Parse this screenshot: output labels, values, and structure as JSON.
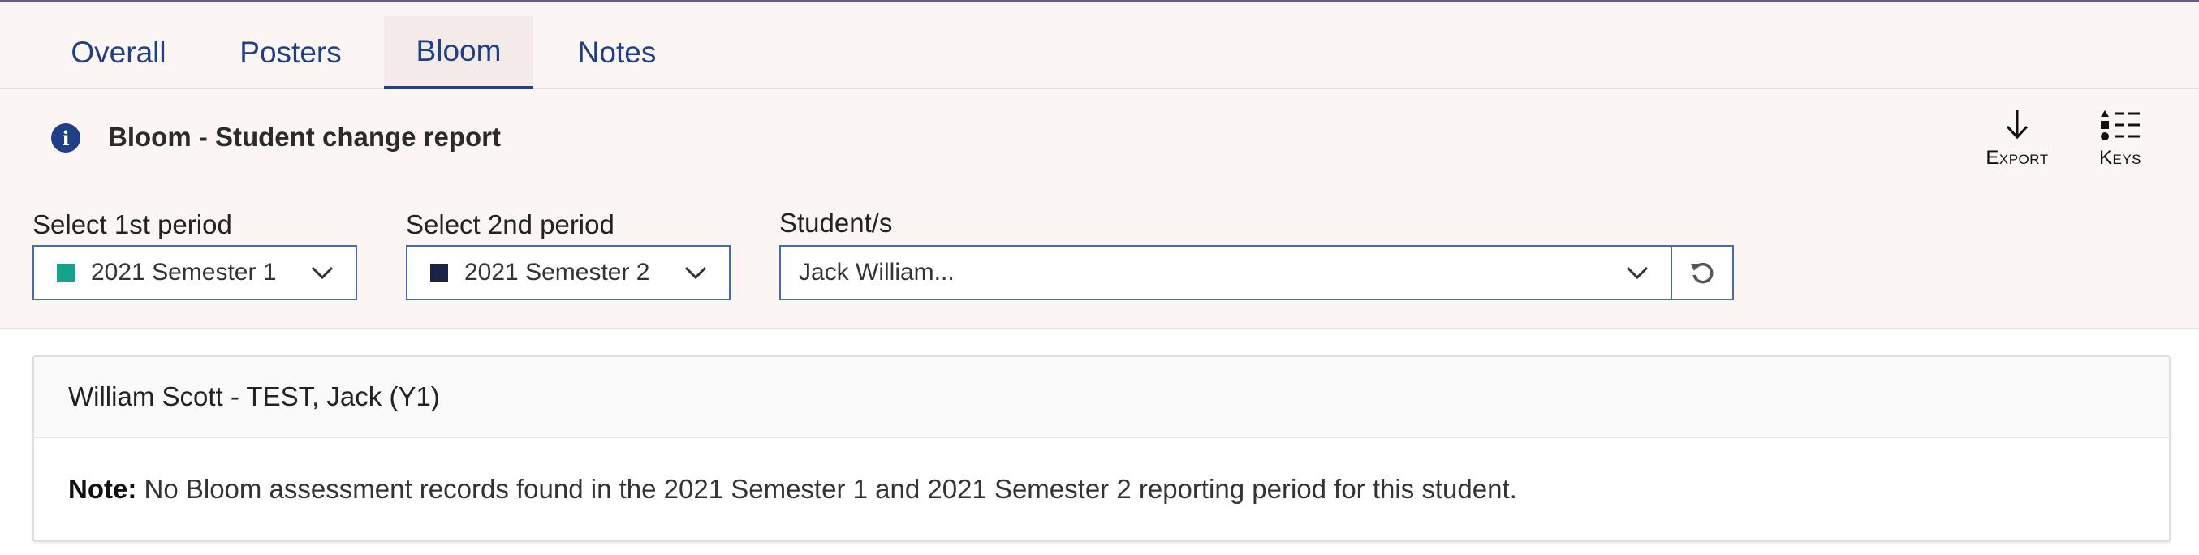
{
  "tabs": [
    {
      "label": "Overall"
    },
    {
      "label": "Posters"
    },
    {
      "label": "Bloom"
    },
    {
      "label": "Notes"
    }
  ],
  "active_tab": "Bloom",
  "report": {
    "title": "Bloom - Student change report",
    "icon": "info-icon"
  },
  "actions": {
    "export_label": "Export",
    "keys_label": "Keys"
  },
  "filters": {
    "period1": {
      "label": "Select 1st period",
      "value": "2021 Semester 1",
      "color": "#14a38b"
    },
    "period2": {
      "label": "Select 2nd period",
      "value": "2021 Semester 2",
      "color": "#1b2444"
    },
    "students": {
      "label": "Student/s",
      "value": "Jack William..."
    }
  },
  "student_card": {
    "header": "William Scott - TEST, Jack (Y1)",
    "note_label": "Note:",
    "note_text": " No Bloom assessment records found in the 2021 Semester 1 and 2021 Semester 2 reporting period for this student."
  }
}
